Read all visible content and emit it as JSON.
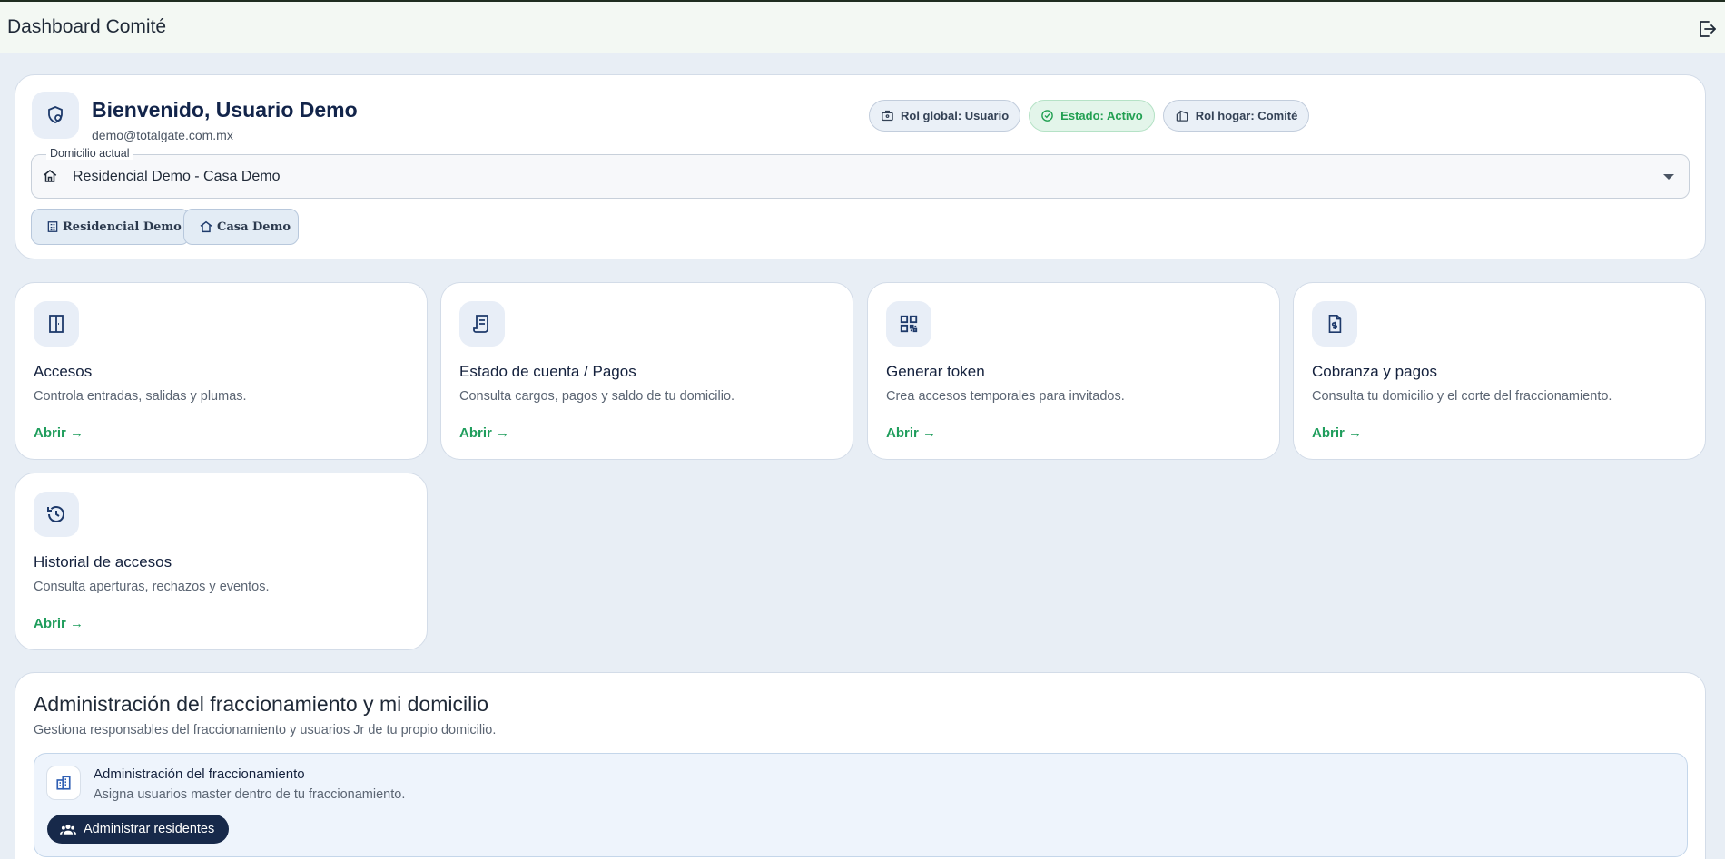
{
  "header": {
    "title": "Dashboard Comité",
    "logout_icon": "logout-icon"
  },
  "welcome": {
    "greeting": "Bienvenido, Usuario Demo",
    "email": "demo@totalgate.com.mx",
    "chips": [
      {
        "label": "Rol global: Usuario",
        "icon": "user-badge-icon"
      },
      {
        "label": "Estado: Activo",
        "icon": "check-circle-icon",
        "color": "#22a052"
      },
      {
        "label": "Rol hogar: Comité",
        "icon": "building-icon"
      }
    ],
    "address_select": {
      "legend": "Domicilio actual",
      "value": "Residencial Demo - Casa Demo"
    },
    "tags": [
      {
        "label": "Residencial Demo",
        "icon": "building-grid-icon"
      },
      {
        "label": "Casa Demo",
        "icon": "house-icon"
      }
    ]
  },
  "modules": [
    {
      "title": "Accesos",
      "desc": "Controla entradas, salidas y plumas.",
      "link": "Abrir →",
      "icon": "door-icon"
    },
    {
      "title": "Estado de cuenta / Pagos",
      "desc": "Consulta cargos, pagos y saldo de tu domicilio.",
      "link": "Abrir →",
      "icon": "receipt-icon"
    },
    {
      "title": "Generar token",
      "desc": "Crea accesos temporales para invitados.",
      "link": "Abrir →",
      "icon": "qr-code-icon"
    },
    {
      "title": "Cobranza y pagos",
      "desc": "Consulta tu domicilio y el corte del fraccionamiento.",
      "link": "Abrir →",
      "icon": "invoice-dollar-icon"
    },
    {
      "title": "Historial de accesos",
      "desc": "Consulta aperturas, rechazos y eventos.",
      "link": "Abrir →",
      "icon": "history-icon"
    }
  ],
  "admin": {
    "title": "Administración del fraccionamiento y mi domicilio",
    "subtitle": "Gestiona responsables del fraccionamiento y usuarios Jr de tu propio domicilio.",
    "box": {
      "title": "Administración del fraccionamiento",
      "subtitle": "Asigna usuarios master dentro de tu fraccionamiento.",
      "button": "Administrar residentes"
    }
  },
  "colors": {
    "accent_green": "#1f9d5c",
    "navy": "#17294a",
    "background": "#e8eef5"
  }
}
